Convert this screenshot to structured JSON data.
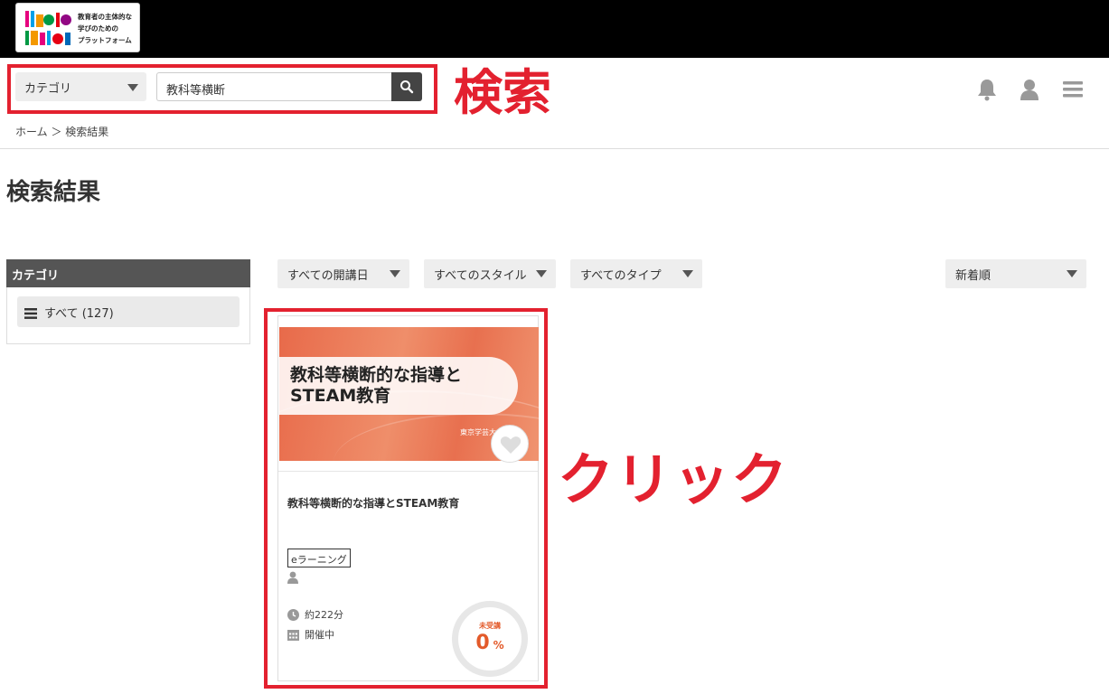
{
  "header": {
    "logo_lines": [
      "教育者の主体的な",
      "学びのための",
      "プラットフォーム"
    ]
  },
  "search": {
    "category_label": "カテゴリ",
    "query": "教科等横断"
  },
  "annotations": {
    "search": "検索",
    "click": "クリック"
  },
  "breadcrumb": "ホーム ＞ 検索結果",
  "page_title": "検索結果",
  "sidebar": {
    "heading": "カテゴリ",
    "items": [
      {
        "label": "すべて (127)"
      }
    ]
  },
  "filters": {
    "date": "すべての開講日",
    "style": "すべてのスタイル",
    "type": "すべてのタイプ",
    "sort": "新着順"
  },
  "card": {
    "thumbnail_title": "教科等横断的な指導と STEAM教育",
    "thumbnail_sub": "東京学芸大",
    "title": "教科等横断的な指導とSTEAM教育",
    "tag": "eラーニング",
    "duration": "約222分",
    "status": "開催中",
    "progress_label": "未受講",
    "progress_value": "0",
    "progress_unit": "%"
  },
  "colors": {
    "annotation_red": "#e3212f",
    "progress_orange": "#e35a2a",
    "header_black": "#000000"
  }
}
